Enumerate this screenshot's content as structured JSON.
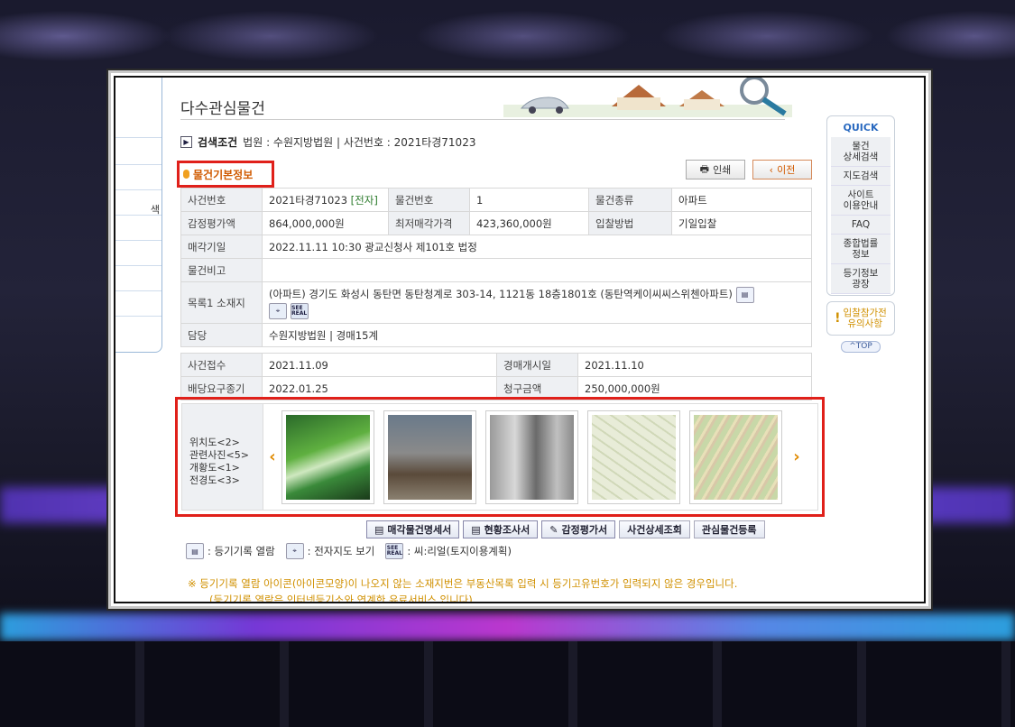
{
  "page": {
    "title": "다수관심물건",
    "search_condition_label": "검색조건",
    "search_condition_text": "법원 : 수원지방법원 | 사건번호 : 2021타경71023",
    "section_title": "물건기본정보",
    "print_label": "인쇄",
    "prev_label": "이전"
  },
  "left_strip": {
    "glyph": "색"
  },
  "table1": {
    "rows": [
      {
        "h1": "사건번호",
        "v1": "2021타경71023",
        "v1b": "[전자]",
        "h2": "물건번호",
        "v2": "1",
        "h3": "물건종류",
        "v3": "아파트"
      },
      {
        "h1": "감정평가액",
        "v1": "864,000,000원",
        "h2": "최저매각가격",
        "v2": "423,360,000원",
        "h3": "입찰방법",
        "v3": "기일입찰"
      }
    ],
    "sale_date_label": "매각기일",
    "sale_date_value": "2022.11.11 10:30 광교신청사 제101호 법정",
    "note_label": "물건비고",
    "note_value": "",
    "location_label": "목록1 소재지",
    "location_value": "(아파트) 경기도 화성시 동탄면 동탄청계로 303-14, 1121동 18층1801호 (동탄역케이씨씨스위첸아파트)",
    "manager_label": "담당",
    "manager_value": "수원지방법원 | 경매15계"
  },
  "table2": {
    "rows": [
      {
        "h1": "사건접수",
        "v1": "2021.11.09",
        "h2": "경매개시일",
        "v2": "2021.11.10"
      },
      {
        "h1": "배당요구종기",
        "v1": "2022.01.25",
        "h2": "청구금액",
        "v2": "250,000,000원"
      }
    ]
  },
  "photos": {
    "labels": [
      "위치도<2>",
      "관련사진<5>",
      "개황도<1>",
      "전경도<3>"
    ]
  },
  "actions": [
    "매각물건명세서",
    "현황조사서",
    "감정평가서",
    "사건상세조회",
    "관심물건등록"
  ],
  "legend": {
    "registry": ": 등기기록 열람",
    "map": ": 전자지도 보기",
    "real": ": 씨:리얼(토지이용계획)"
  },
  "notes": [
    "※ 등기기록 열람 아이콘(아이콘모양)이 나오지 않는 소재지번은 부동산목록 입력 시 등기고유번호가 입력되지 않은 경우입니다.",
    "(등기기록 열람은 인터넷등기소와 연계한 유료서비스 입니다)"
  ],
  "quick": {
    "title": "QUICK",
    "items": [
      "물건\n상세검색",
      "지도검색",
      "사이트\n이용안내",
      "FAQ",
      "종합법률\n정보",
      "등기정보\n광장"
    ],
    "caution": "입찰참가전\n유의사항",
    "top": "^TOP"
  },
  "icons": [
    "print-icon",
    "chevron-left-icon",
    "registry-icon",
    "map-icon",
    "sea-real-icon",
    "chevron-left-icon",
    "chevron-right-icon"
  ],
  "colors": {
    "accent": "#e0201a",
    "section": "#d05a00",
    "note": "#d09000",
    "quick": "#2a6ac0"
  }
}
